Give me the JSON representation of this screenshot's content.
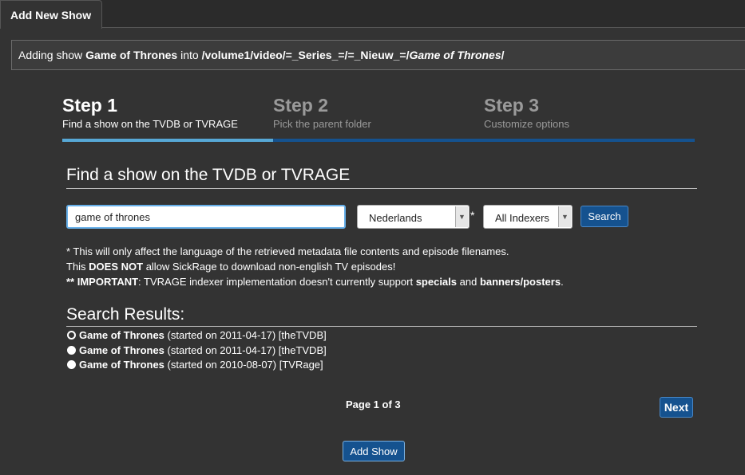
{
  "tab": {
    "label": "Add New Show"
  },
  "info": {
    "prefix": "Adding show ",
    "show": "Game of Thrones",
    "middle": " into ",
    "path": "/volume1/video/=_Series_=/=_Nieuw_=/",
    "folder": "Game of Thrones",
    "suffix": "/"
  },
  "steps": [
    {
      "num": "Step 1",
      "sub": "Find a show on the TVDB or TVRAGE"
    },
    {
      "num": "Step 2",
      "sub": "Pick the parent folder"
    },
    {
      "num": "Step 3",
      "sub": "Customize options"
    }
  ],
  "progress": {
    "current_step": 1,
    "total_steps": 3
  },
  "section": {
    "title": "Find a show on the TVDB or TVRAGE"
  },
  "search": {
    "value": "game of thrones",
    "language": "Nederlands",
    "asterisk": "*",
    "indexer": "All Indexers",
    "button": "Search"
  },
  "notes": {
    "line1": "* This will only affect the language of the retrieved metadata file contents and episode filenames.",
    "line2_pre": "This ",
    "line2_bold": "DOES NOT",
    "line2_post": " allow SickRage to download non-english TV episodes!",
    "line3_bold1": "** IMPORTANT",
    "line3_mid": ": TVRAGE indexer implementation doesn't currently support ",
    "line3_bold2": "specials",
    "line3_and": " and ",
    "line3_bold3": "banners/posters",
    "line3_end": "."
  },
  "results": {
    "title": "Search Results:",
    "items": [
      {
        "name": "Game of Thrones",
        "detail": " (started on 2011-04-17) [theTVDB]",
        "selected": true
      },
      {
        "name": "Game of Thrones",
        "detail": " (started on 2011-04-17) [theTVDB]",
        "selected": false
      },
      {
        "name": "Game of Thrones",
        "detail": " (started on 2010-08-07) [TVRage]",
        "selected": false
      }
    ]
  },
  "pager": {
    "label": "Page 1 of 3",
    "next": "Next"
  },
  "add_button": "Add Show"
}
